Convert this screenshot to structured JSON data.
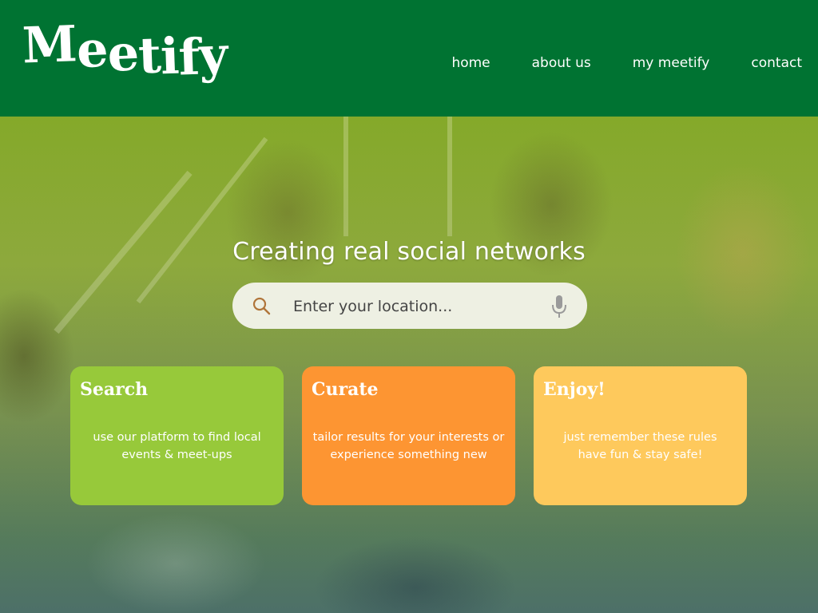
{
  "brand": {
    "logo_text": "Meetify",
    "logo_letters": [
      "M",
      "e",
      "e",
      "t",
      "i",
      "f",
      "y"
    ]
  },
  "nav": {
    "items": [
      "home",
      "about us",
      "my meetify",
      "contact"
    ]
  },
  "hero": {
    "headline": "Creating real social networks",
    "search": {
      "placeholder": "Enter your location...",
      "value": "",
      "icons": [
        "search-icon",
        "microphone-icon"
      ]
    }
  },
  "cards": [
    {
      "title": "Search",
      "text_lines": [
        "use our platform to find local",
        "events & meet-ups"
      ],
      "color": "#97c93a"
    },
    {
      "title": "Curate",
      "text_lines": [
        "tailor results for your interests or",
        "experience something new"
      ],
      "color": "#fd9532"
    },
    {
      "title": "Enjoy!",
      "text_lines": [
        "just remember these rules",
        "have fun & stay safe!"
      ],
      "color": "#fec95c"
    }
  ],
  "colors": {
    "header_bg": "#007332",
    "text_on_dark": "#ffffff"
  }
}
